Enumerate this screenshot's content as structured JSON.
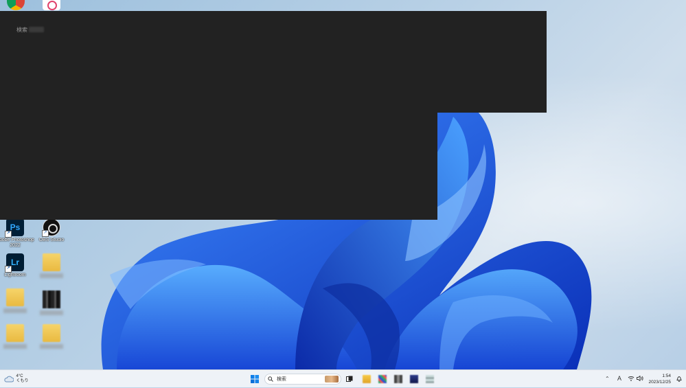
{
  "desktop": {
    "icons": [
      {
        "name": "photoshop",
        "label": "Adobe Photoshop 2022"
      },
      {
        "name": "obs",
        "label": "OBS Studio"
      },
      {
        "name": "lightroom",
        "label": "Lightroom"
      }
    ]
  },
  "search_panel": {
    "label": "検索"
  },
  "taskbar": {
    "weather": {
      "temp": "4°C",
      "condition": "くもり"
    },
    "search": {
      "placeholder": "検索"
    },
    "tray": {
      "ime": "A"
    },
    "clock": {
      "time": "1:54",
      "date": "2023/12/25"
    }
  },
  "colors": {
    "accent": "#0067c0",
    "panel": "#222222",
    "taskbar": "#eef2f7"
  }
}
